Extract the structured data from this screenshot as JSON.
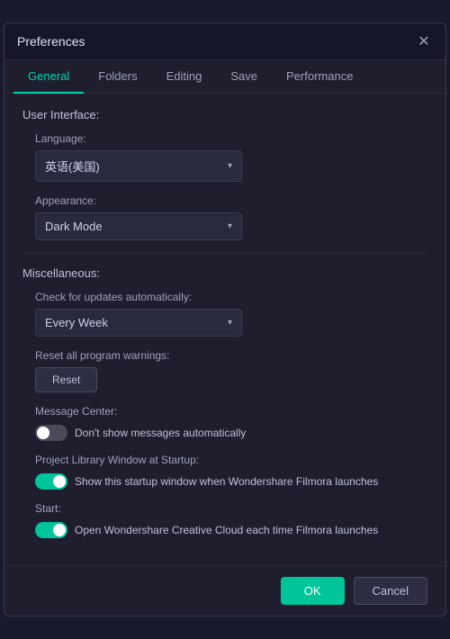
{
  "dialog": {
    "title": "Preferences"
  },
  "tabs": [
    {
      "label": "General",
      "active": true
    },
    {
      "label": "Folders",
      "active": false
    },
    {
      "label": "Editing",
      "active": false
    },
    {
      "label": "Save",
      "active": false
    },
    {
      "label": "Performance",
      "active": false
    }
  ],
  "sections": {
    "user_interface": {
      "label": "User Interface:",
      "language": {
        "label": "Language:",
        "value": "英语(美国)"
      },
      "appearance": {
        "label": "Appearance:",
        "value": "Dark Mode"
      }
    },
    "miscellaneous": {
      "label": "Miscellaneous:",
      "check_updates": {
        "label": "Check for updates automatically:",
        "value": "Every Week"
      },
      "reset": {
        "label": "Reset all program warnings:",
        "button": "Reset"
      },
      "message_center": {
        "label": "Message Center:",
        "toggle_label": "Don't show messages automatically",
        "toggle_on": false
      },
      "project_library": {
        "label": "Project Library Window at Startup:",
        "toggle_label": "Show this startup window when Wondershare Filmora launches",
        "toggle_on": true
      },
      "start": {
        "label": "Start:",
        "toggle_label": "Open Wondershare Creative Cloud each time Filmora launches",
        "toggle_on": true
      }
    }
  },
  "footer": {
    "ok_label": "OK",
    "cancel_label": "Cancel"
  },
  "icons": {
    "close": "✕",
    "chevron_down": "▾"
  }
}
